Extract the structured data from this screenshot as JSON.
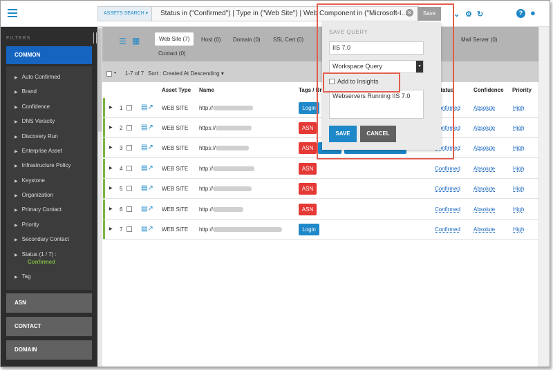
{
  "search": {
    "chip": "ASSETS SEARCH ▾",
    "query": "Status in (\"Confirmed\") | Type in (\"Web Site\") | Web Component in (\"Microsoft-I...",
    "save_label": "Save"
  },
  "sidebar": {
    "title": "FILTERS",
    "common": "COMMON",
    "items": [
      "Auto Confirmed",
      "Brand",
      "Confidence",
      "DNS Veracity",
      "Discovery Run",
      "Enterprise Asset",
      "Infrastructure Policy",
      "Keystone",
      "Organization",
      "Primary Contact",
      "Priority",
      "Secondary Contact",
      "Status (1 / 7) :",
      "Tag"
    ],
    "status_value": "Confirmed",
    "groups": [
      "ASN",
      "CONTACT",
      "DOMAIN"
    ]
  },
  "tabs": [
    "Web Site (7)",
    "Host (0)",
    "Domain (0)",
    "SSL Cert (0)",
    "Mail Server (0)",
    "Contact (0)"
  ],
  "list": {
    "count": "1-7 of 7",
    "sort": "Sort : Created At Descending ▾"
  },
  "columns": [
    "Asset Type",
    "Name",
    "Tags / Br",
    "Status",
    "Confidence",
    "Priority"
  ],
  "rows": [
    {
      "n": "1",
      "type": "WEB SITE",
      "proto": "http://",
      "tag": "Login",
      "status": "Confirmed",
      "confidence": "Absolute",
      "priority": "High"
    },
    {
      "n": "2",
      "type": "WEB SITE",
      "proto": "https://",
      "tag": "ASN",
      "status": "Confirmed",
      "confidence": "Absolute",
      "priority": "High"
    },
    {
      "n": "3",
      "type": "WEB SITE",
      "proto": "https://",
      "tag": "ASN",
      "status": "Confirmed",
      "confidence": "Absolute",
      "priority": "High"
    },
    {
      "n": "4",
      "type": "WEB SITE",
      "proto": "http://",
      "tag": "ASN",
      "status": "Confirmed",
      "confidence": "Absolute",
      "priority": "High"
    },
    {
      "n": "5",
      "type": "WEB SITE",
      "proto": "http://",
      "tag": "ASN",
      "status": "Confirmed",
      "confidence": "Absolute",
      "priority": "High"
    },
    {
      "n": "6",
      "type": "WEB SITE",
      "proto": "http://",
      "tag": "ASN",
      "status": "Confirmed",
      "confidence": "Absolute",
      "priority": "High"
    },
    {
      "n": "7",
      "type": "WEB SITE",
      "proto": "http://",
      "tag": "Login",
      "status": "Confirmed",
      "confidence": "Absolute",
      "priority": "High"
    }
  ],
  "popup": {
    "title": "SAVE QUERY",
    "name_value": "IIS 7.0",
    "workspace": "Workspace Query",
    "insights_label": "Add to Insights",
    "description": "Webservers Running IIS 7.0",
    "save": "SAVE",
    "cancel": "CANCEL"
  },
  "colors": {
    "accent": "#1e88c8",
    "asn": "#e53935",
    "highlight": "#e25d4d",
    "confirmed": "#7cb342"
  }
}
